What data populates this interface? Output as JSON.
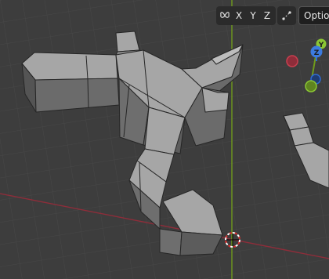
{
  "viewport": {
    "header": {
      "symmetry_axes": [
        "X",
        "Y",
        "Z"
      ],
      "options_label": "Options",
      "mirror_icon": "butterfly-mirror-icon",
      "snap_icon": "snap-icon"
    },
    "gizmo": {
      "axes": [
        "Z",
        "Y"
      ]
    }
  },
  "colors": {
    "background": "#3d3d3d",
    "grid": "#474747",
    "x_axis": "#8e2d3a",
    "y_axis": "#6f9a1c",
    "face_top": "#a6a6a6",
    "face_side": "#6a6a6a",
    "edge": "#262626",
    "header_bg": "#2b2b2b"
  }
}
